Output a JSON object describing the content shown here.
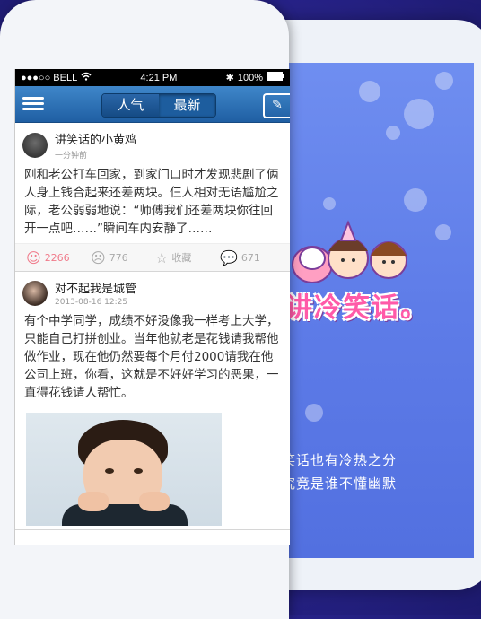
{
  "statusbar": {
    "carrier": "●●●○○ BELL",
    "time": "4:21 PM",
    "battery": "100%"
  },
  "navbar": {
    "tab_popular": "人气",
    "tab_latest": "最新"
  },
  "posts": [
    {
      "user": "讲笑话的小黄鸡",
      "time": "一分钟前",
      "text": "刚和老公打车回家，到家门口时才发现悲剧了俩人身上钱合起来还差两块。仨人相对无语尴尬之际，老公弱弱地说：“师傅我们还差两块你往回开一点吧……”瞬间车内安静了……",
      "likes": "2266",
      "dislikes": "776",
      "favorite": "收藏",
      "comments": "671"
    },
    {
      "user": "对不起我是城管",
      "time": "2013-08-16  12:25",
      "text": "有个中学同学，成绩不好没像我一样考上大学，只能自己打拼创业。当年他就老是花钱请我帮他做作业，现在他仍然要每个月付2000请我在他公司上班，你看，这就是不好好学习的恶果，一直得花钱请人帮忙。"
    }
  ],
  "splash": {
    "logo": "讲冷笑话。",
    "tagline1": "笑话也有冷热之分",
    "tagline2": "究竟是谁不懂幽默"
  },
  "colors": {
    "nav": "#1f5fa3",
    "splash": "#6f8ef0",
    "hot": "#f07a8a"
  }
}
